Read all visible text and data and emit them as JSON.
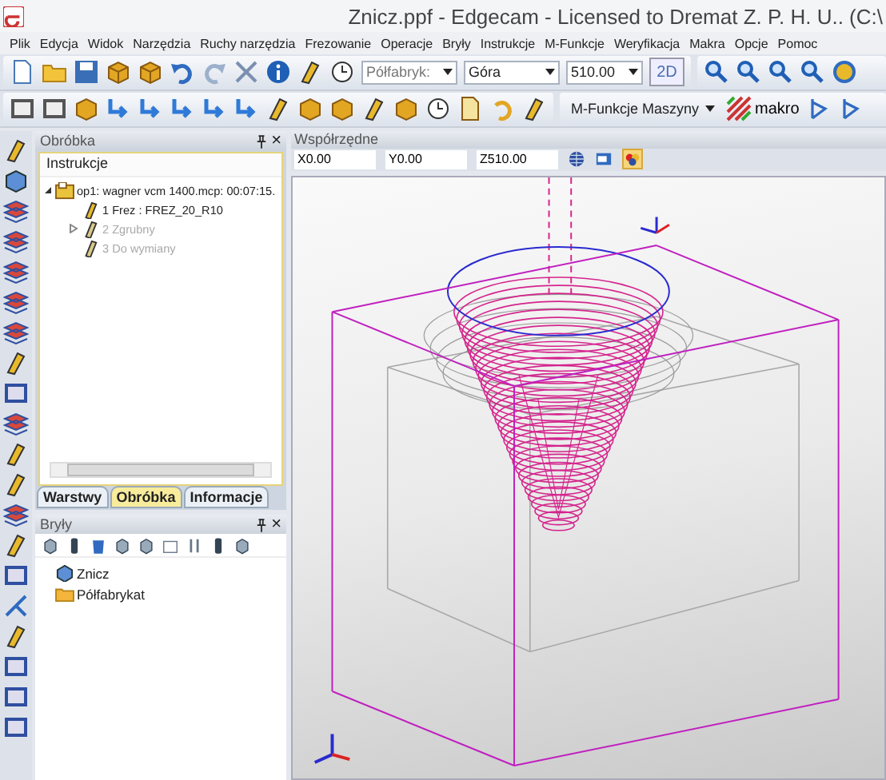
{
  "window": {
    "title": "Znicz.ppf - Edgecam - Licensed to Dremat Z. P. H. U.. (C:\\"
  },
  "menu": [
    "Plik",
    "Edycja",
    "Widok",
    "Narzędzia",
    "Ruchy narzędzia",
    "Frezowanie",
    "Operacje",
    "Bryły",
    "Instrukcje",
    "M-Funkcje",
    "Weryfikacja",
    "Makra",
    "Opcje",
    "Pomoc"
  ],
  "toolbar": {
    "stock_dropdown": "Półfabryk:",
    "view_dropdown": "Góra",
    "height_dropdown": "510.00",
    "mode_button": "2D",
    "machine_functions_dropdown": "M-Funkcje Maszyny",
    "macro_button": "makro"
  },
  "machining_panel": {
    "title": "Obróbka",
    "close": "×",
    "header": "Instrukcje",
    "tree": [
      {
        "label": "op1: wagner vcm 1400.mcp: 00:07:15.",
        "disabled": false,
        "expanded": true,
        "children": [
          {
            "label": "1 Frez : FREZ_20_R10",
            "disabled": false
          },
          {
            "label": "2 Zgrubny",
            "disabled": true,
            "expanded": false
          },
          {
            "label": "3 Do wymiany",
            "disabled": true
          }
        ]
      }
    ],
    "tabs": [
      {
        "label": "Warstwy",
        "selected": false
      },
      {
        "label": "Obróbka",
        "selected": true
      },
      {
        "label": "Informacje",
        "selected": false
      }
    ]
  },
  "solids_panel": {
    "title": "Bryły",
    "close": "×",
    "items": [
      "Znicz",
      "Półfabrykat"
    ]
  },
  "coordinates": {
    "title": "Współrzędne",
    "x": "X0.00",
    "y": "Y0.00",
    "z": "Z510.00"
  }
}
